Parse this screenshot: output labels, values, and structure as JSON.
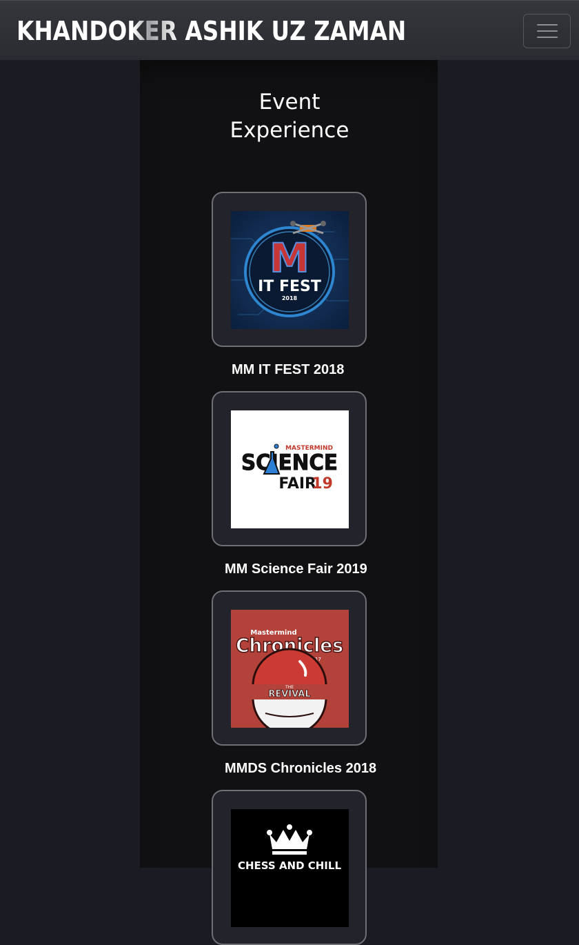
{
  "navbar": {
    "brand": "KHANDOKER ASHIK UZ ZAMAN",
    "menu_icon": "hamburger-menu-icon"
  },
  "section": {
    "title_line1": "Event",
    "title_line2": "Experience"
  },
  "events": [
    {
      "caption": "MM IT FEST 2018",
      "logo_text_main": "IT FEST",
      "logo_text_sub": "2018",
      "logo_mark": "M"
    },
    {
      "caption": "MM Science Fair 2019",
      "logo_text_top": "MASTERMIND",
      "logo_text_main": "SCIENCE",
      "logo_text_fair": "FAIR",
      "logo_text_year": "19"
    },
    {
      "caption": "MMDS Chronicles 2018",
      "logo_text_top": "Mastermind",
      "logo_text_main": "Chronicles",
      "logo_text_year": "2017",
      "logo_text_the": "THE",
      "logo_text_sub": "REVIVAL"
    },
    {
      "logo_text_main": "CHESS AND CHILL",
      "logo_icon": "crown-icon"
    }
  ],
  "colors": {
    "background": "#1a1b23",
    "column": "#111113",
    "card": "#22232b",
    "card_border": "#6f7075"
  }
}
